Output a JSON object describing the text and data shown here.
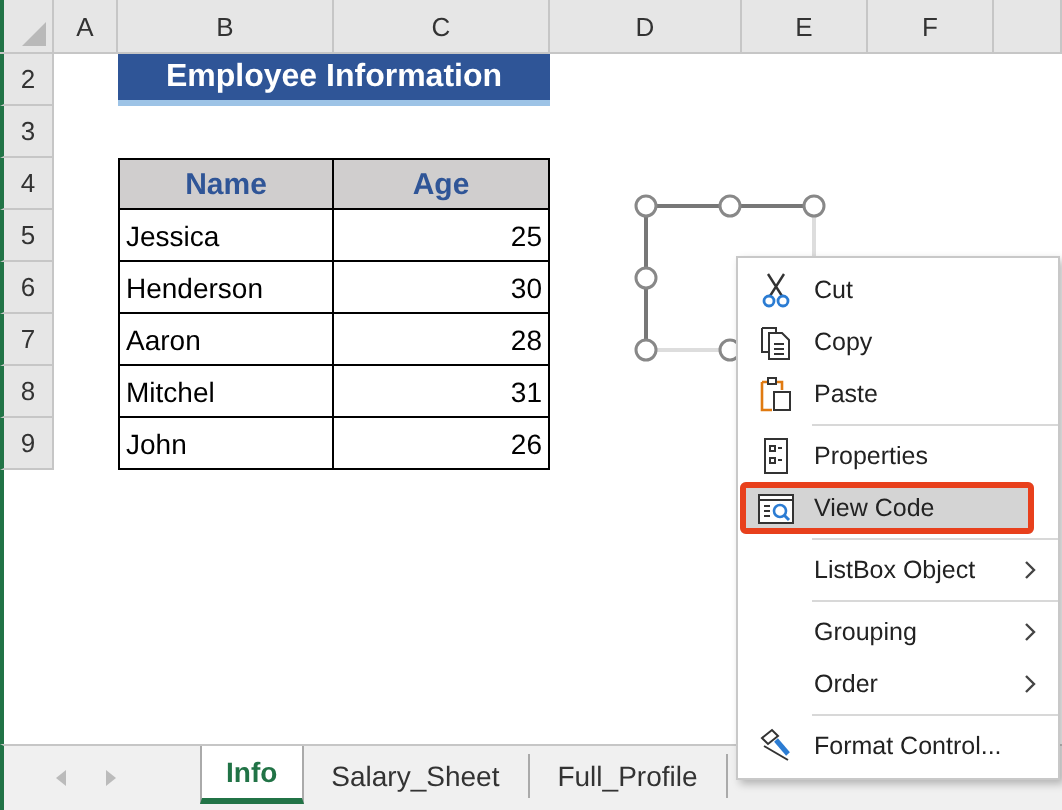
{
  "sheet": {
    "columns": [
      "A",
      "B",
      "C",
      "D",
      "E",
      "F"
    ],
    "rows": [
      {
        "number": "2",
        "kind": "title",
        "cells": [
          "",
          "Employee Information"
        ]
      },
      {
        "number": "3",
        "kind": "blank",
        "cells": []
      },
      {
        "number": "4",
        "kind": "header",
        "cells": [
          "",
          "Name",
          "Age"
        ]
      },
      {
        "number": "5",
        "kind": "data",
        "cells": [
          "",
          "Jessica",
          "25"
        ]
      },
      {
        "number": "6",
        "kind": "data",
        "cells": [
          "",
          "Henderson",
          "30"
        ]
      },
      {
        "number": "7",
        "kind": "data",
        "cells": [
          "",
          "Aaron",
          "28"
        ]
      },
      {
        "number": "8",
        "kind": "data",
        "cells": [
          "",
          "Mitchel",
          "31"
        ]
      },
      {
        "number": "9",
        "kind": "data",
        "cells": [
          "",
          "John",
          "26"
        ]
      }
    ]
  },
  "context_menu": [
    {
      "kind": "item",
      "label": "Cut",
      "submenu": false,
      "selected": false
    },
    {
      "kind": "item",
      "label": "Copy",
      "submenu": false,
      "selected": false
    },
    {
      "kind": "item",
      "label": "Paste",
      "submenu": false,
      "selected": false
    },
    {
      "kind": "separator"
    },
    {
      "kind": "item",
      "label": "Properties",
      "submenu": false,
      "selected": false
    },
    {
      "kind": "item",
      "label": "View Code",
      "submenu": false,
      "selected": true
    },
    {
      "kind": "separator"
    },
    {
      "kind": "item",
      "label": "ListBox Object",
      "submenu": true,
      "selected": false
    },
    {
      "kind": "separator"
    },
    {
      "kind": "item",
      "label": "Grouping",
      "submenu": true,
      "selected": false
    },
    {
      "kind": "item",
      "label": "Order",
      "submenu": true,
      "selected": false
    },
    {
      "kind": "separator"
    },
    {
      "kind": "item",
      "label": "Format Control...",
      "submenu": false,
      "selected": false
    }
  ],
  "sheet_tabs": [
    {
      "label": "Info",
      "selected": true
    },
    {
      "label": "Salary_Sheet",
      "selected": false
    },
    {
      "label": "Full_Profile",
      "selected": false
    }
  ]
}
